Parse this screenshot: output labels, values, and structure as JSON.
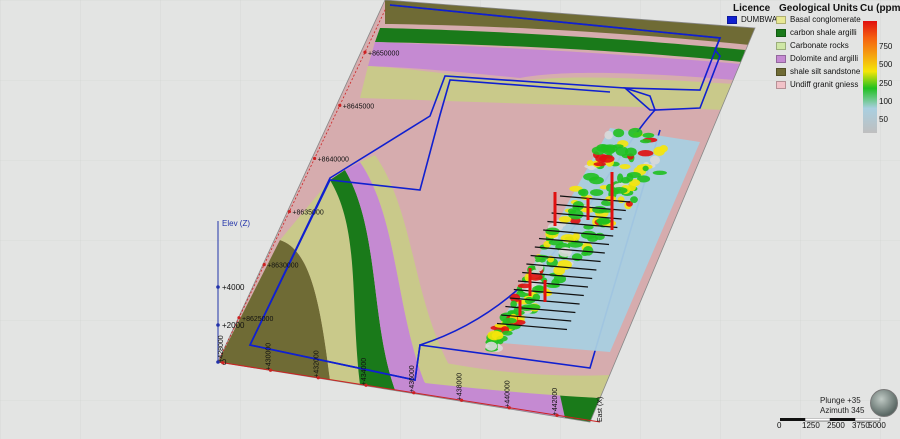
{
  "legend": {
    "licence_title": "Licence",
    "licence_items": [
      {
        "label": "DUMBWA",
        "color": "#1020d0"
      }
    ],
    "units_title": "Geological Units",
    "units": [
      {
        "label": "Basal conglomerate",
        "color": "#e8e894"
      },
      {
        "label": "carbon shale argilli",
        "color": "#1a7a1a"
      },
      {
        "label": "Carbonate rocks",
        "color": "#cfe7a5"
      },
      {
        "label": "Dolomite and argilli",
        "color": "#c58ad2"
      },
      {
        "label": "shale silt sandstone",
        "color": "#6f6b35"
      },
      {
        "label": "Undiff granit gniess",
        "color": "#f2c2c8"
      }
    ],
    "cu_title": "Cu (ppm)",
    "cu_ticks": [
      "750",
      "500",
      "250",
      "100",
      "50"
    ]
  },
  "axes": {
    "elev_label": "Elev (Z)",
    "elev_ticks": [
      "+4000",
      "+2000",
      "0"
    ],
    "north_ticks": [
      "+8650000",
      "+8645000",
      "+8640000",
      "+8635000",
      "+8630000",
      "+8625000"
    ],
    "east_ticks": [
      "+428000",
      "+430000",
      "+432000",
      "+434000",
      "+436000",
      "+438000",
      "+440000",
      "+442000"
    ],
    "east_label": "East (X)"
  },
  "view": {
    "plunge": "Plunge +35",
    "azimuth": "Azimuth 345"
  },
  "scale": {
    "labels": [
      "0",
      "1250",
      "2500",
      "3750",
      "5000"
    ]
  },
  "colors": {
    "background": "#e3e4e3",
    "licence_boundary": "#1020d0",
    "cu_high": "#e01010",
    "cu_mid": "#f5e60a",
    "cu_low": "#20c020",
    "cu_base": "#a9cfe0"
  }
}
